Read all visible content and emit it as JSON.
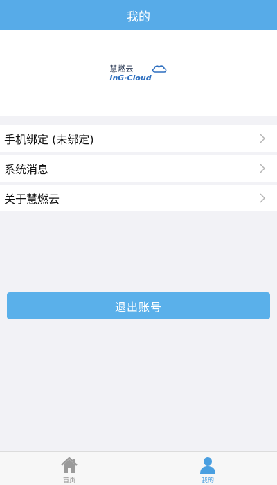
{
  "header": {
    "title": "我的"
  },
  "logo": {
    "cn_text": "慧燃云",
    "en_text": "InG·Cloud"
  },
  "menu": {
    "items": [
      {
        "label": "手机绑定 (未绑定)"
      },
      {
        "label": "系统消息"
      },
      {
        "label": "关于慧燃云"
      }
    ]
  },
  "logout": {
    "label": "退出账号"
  },
  "tabbar": {
    "tabs": [
      {
        "label": "首页",
        "icon": "home-icon",
        "active": false
      },
      {
        "label": "我的",
        "icon": "user-icon",
        "active": true
      }
    ]
  },
  "colors": {
    "accent": "#57abe8",
    "button": "#5ab0ea",
    "background": "#f2f2f6",
    "active_tab": "#4a9fe0",
    "inactive_tab": "#8a8a8a"
  }
}
